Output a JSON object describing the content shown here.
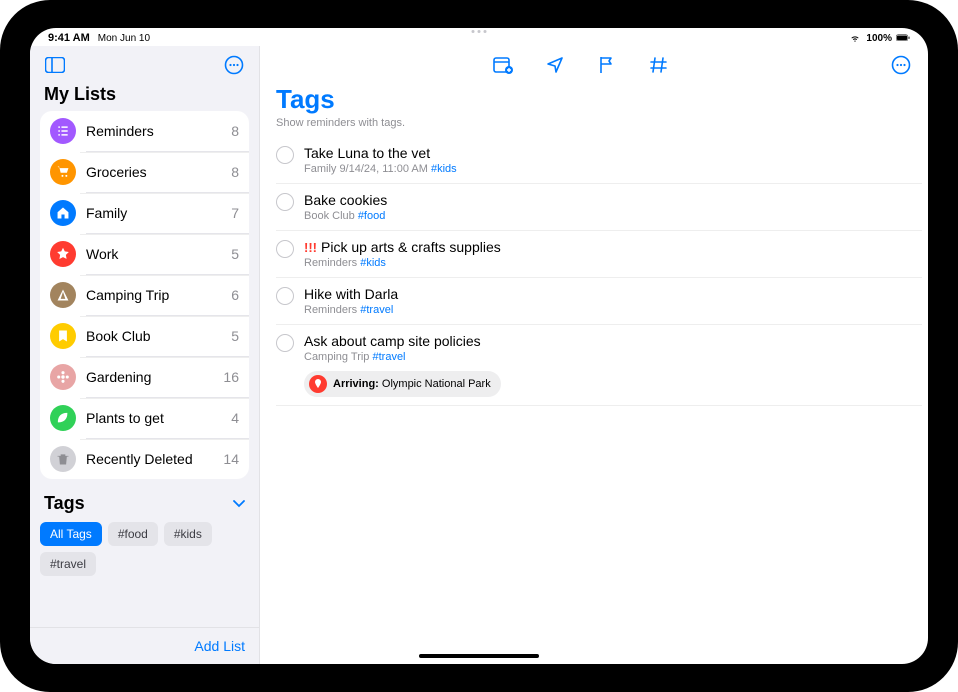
{
  "status": {
    "time": "9:41 AM",
    "date": "Mon Jun 10",
    "battery": "100%"
  },
  "sidebar": {
    "header": "My Lists",
    "lists": [
      {
        "name": "Reminders",
        "count": "8",
        "color": "#a259ff",
        "icon": "list"
      },
      {
        "name": "Groceries",
        "count": "8",
        "color": "#ff9500",
        "icon": "cart"
      },
      {
        "name": "Family",
        "count": "7",
        "color": "#007aff",
        "icon": "house"
      },
      {
        "name": "Work",
        "count": "5",
        "color": "#ff3b30",
        "icon": "star"
      },
      {
        "name": "Camping Trip",
        "count": "6",
        "color": "#a2845e",
        "icon": "tent"
      },
      {
        "name": "Book Club",
        "count": "5",
        "color": "#ffcc00",
        "icon": "bookmark"
      },
      {
        "name": "Gardening",
        "count": "16",
        "color": "#e8a5a5",
        "icon": "flower"
      },
      {
        "name": "Plants to get",
        "count": "4",
        "color": "#30d158",
        "icon": "leaf"
      },
      {
        "name": "Recently Deleted",
        "count": "14",
        "color": "#d1d1d6",
        "icon": "trash"
      }
    ],
    "tagsHeader": "Tags",
    "tags": [
      {
        "label": "All Tags",
        "active": true
      },
      {
        "label": "#food",
        "active": false
      },
      {
        "label": "#kids",
        "active": false
      },
      {
        "label": "#travel",
        "active": false
      }
    ],
    "addList": "Add List"
  },
  "main": {
    "title": "Tags",
    "subtitle": "Show reminders with tags.",
    "reminders": [
      {
        "title": "Take Luna to the vet",
        "meta_prefix": "Family  9/14/24, 11:00 AM  ",
        "tag": "#kids",
        "priority": ""
      },
      {
        "title": "Bake cookies",
        "meta_prefix": "Book Club  ",
        "tag": "#food",
        "priority": ""
      },
      {
        "title": "Pick up arts & crafts supplies",
        "meta_prefix": "Reminders  ",
        "tag": "#kids",
        "priority": "!!!"
      },
      {
        "title": "Hike with Darla",
        "meta_prefix": "Reminders  ",
        "tag": "#travel",
        "priority": ""
      },
      {
        "title": "Ask about camp site policies",
        "meta_prefix": "Camping Trip  ",
        "tag": "#travel",
        "priority": "",
        "location_label": "Arriving:",
        "location_value": " Olympic National Park"
      }
    ]
  }
}
